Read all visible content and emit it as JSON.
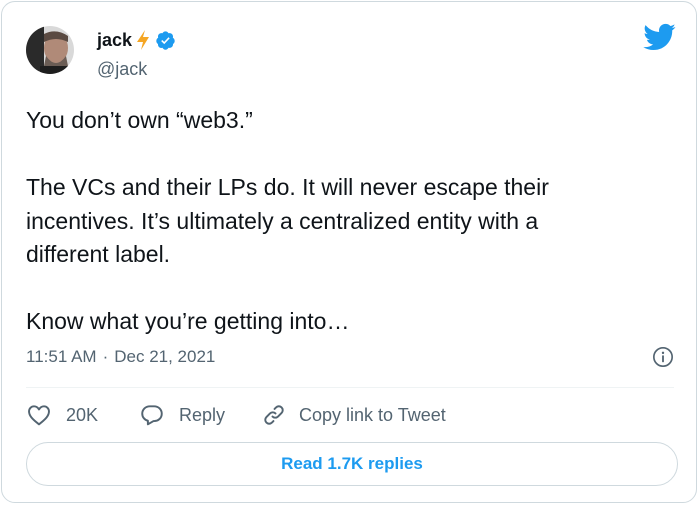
{
  "author": {
    "name": "jack",
    "handle": "@jack",
    "avatar_icon": "profile-photo",
    "badge_icon": "verified-badge-icon",
    "emoji_icon": "lightning-bolt-icon"
  },
  "brand": {
    "icon": "twitter-bird-icon",
    "color": "#1d9bf0"
  },
  "tweet": {
    "text": "You don’t own “web3.”\n\nThe VCs and their LPs do. It will never escape their\nincentives. It’s ultimately a centralized entity with a\ndifferent label.\n\nKnow what you’re getting into…"
  },
  "meta": {
    "time": "11:51 AM",
    "separator": "·",
    "date": "Dec 21, 2021",
    "info_icon": "info-icon"
  },
  "actions": {
    "like_count": "20K",
    "reply_label": "Reply",
    "copy_label": "Copy link to Tweet"
  },
  "footer": {
    "read_replies_label": "Read 1.7K replies"
  },
  "colors": {
    "text": "#0f1419",
    "secondary": "#536471",
    "accent": "#1d9bf0",
    "border": "#cfd9de",
    "bolt": "#f5a623"
  }
}
